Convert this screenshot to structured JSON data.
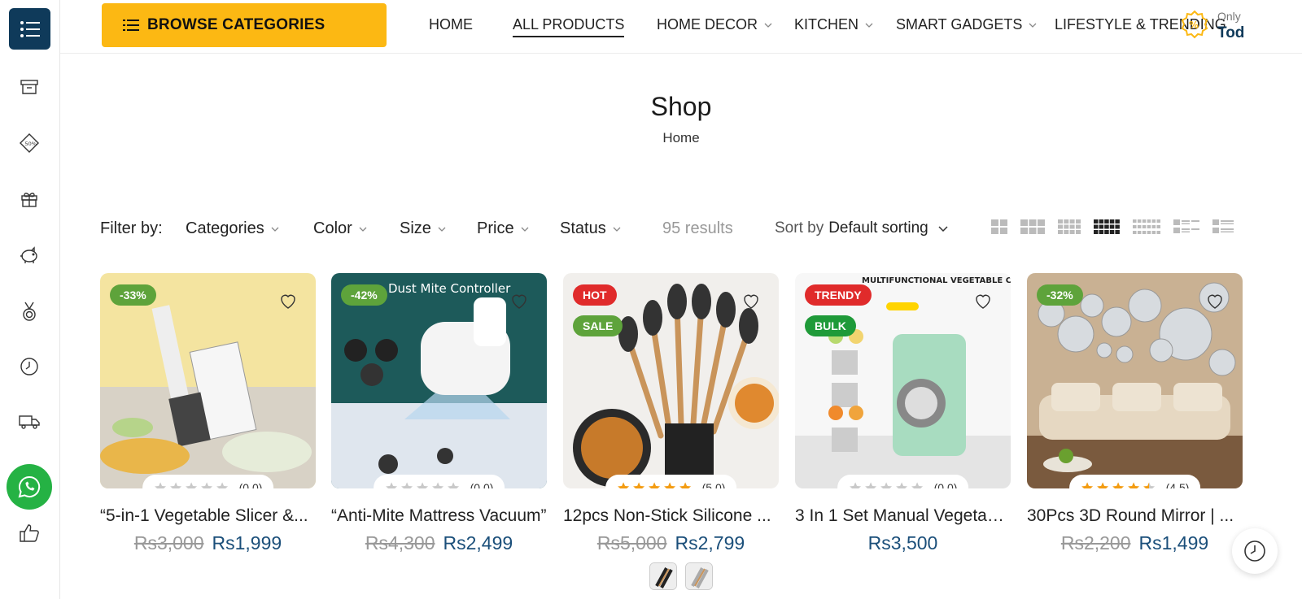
{
  "header": {
    "browse_label": "BROWSE CATEGORIES",
    "nav": [
      {
        "label": "HOME",
        "dropdown": false,
        "active": false
      },
      {
        "label": "ALL PRODUCTS",
        "dropdown": false,
        "active": true
      },
      {
        "label": "HOME DECOR",
        "dropdown": true,
        "active": false
      },
      {
        "label": "KITCHEN",
        "dropdown": true,
        "active": false
      },
      {
        "label": "SMART GADGETS",
        "dropdown": true,
        "active": false
      },
      {
        "label": "LIFESTYLE & TRENDING",
        "dropdown": false,
        "active": false
      }
    ],
    "promo_small": "Only",
    "promo_big": "Tod"
  },
  "page": {
    "title": "Shop",
    "breadcrumb": "Home"
  },
  "filters": {
    "label": "Filter by:",
    "items": [
      "Categories",
      "Color",
      "Size",
      "Price",
      "Status"
    ],
    "results": "95 results",
    "sort_label": "Sort by",
    "sort_value": "Default sorting"
  },
  "rail_icons": [
    "box-icon",
    "discount-tag-icon",
    "gift-icon",
    "piggy-bank-icon",
    "medal-icon",
    "clock-icon",
    "truck-icon",
    "whatsapp-icon",
    "thumbs-up-icon"
  ],
  "products": [
    {
      "name": "“5-in-1 Vegetable Slicer &...",
      "old_price": "Rs3,000",
      "price": "Rs1,999",
      "rating_text": "(0.0)",
      "rating": 0,
      "badges": [
        {
          "text": "-33%",
          "color": "#5ea33b"
        }
      ],
      "image_text": ""
    },
    {
      "name": "“Anti-Mite Mattress Vacuum”",
      "old_price": "Rs4,300",
      "price": "Rs2,499",
      "rating_text": "(0.0)",
      "rating": 0,
      "badges": [
        {
          "text": "-42%",
          "color": "#5ea33b"
        }
      ],
      "image_text": "Dust Mite Controller"
    },
    {
      "name": "12pcs Non-Stick Silicone ...",
      "old_price": "Rs5,000",
      "price": "Rs2,799",
      "rating_text": "(5.0)",
      "rating": 5,
      "badges": [
        {
          "text": "HOT",
          "color": "#e02b2b"
        },
        {
          "text": "SALE",
          "color": "#5ea33b"
        }
      ],
      "image_text": ""
    },
    {
      "name": "3 In 1 Set Manual Vegetab...",
      "old_price": "",
      "price": "Rs3,500",
      "rating_text": "(0.0)",
      "rating": 0,
      "badges": [
        {
          "text": "TRENDY",
          "color": "#e02b2b"
        },
        {
          "text": "BULK",
          "color": "#1f9a39"
        }
      ],
      "image_text": "MULTIFUNCTIONAL VEGETABLE CUTTER"
    },
    {
      "name": "30Pcs 3D Round Mirror | ...",
      "old_price": "Rs2,200",
      "price": "Rs1,499",
      "rating_text": "(4.5)",
      "rating": 4.5,
      "badges": [
        {
          "text": "-32%",
          "color": "#5ea33b"
        }
      ],
      "image_text": ""
    }
  ],
  "colors": {
    "accent": "#fcb813",
    "navy": "#0f3a5a",
    "price": "#1b4f7a",
    "whatsapp": "#25b244",
    "star": "#f39c12"
  }
}
